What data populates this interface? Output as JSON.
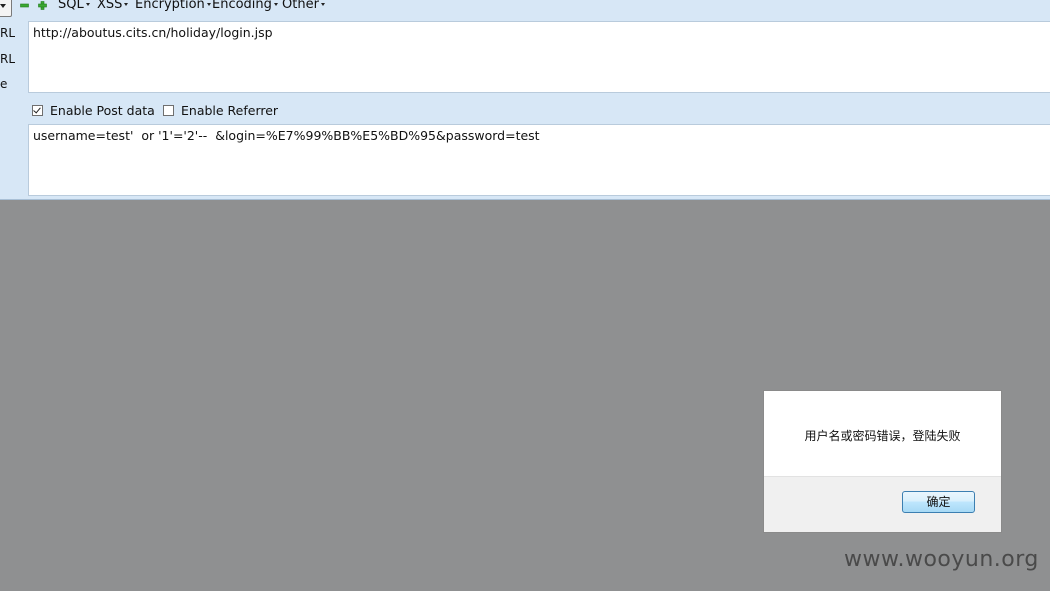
{
  "toolbar": {
    "menus": [
      {
        "label": "SQL"
      },
      {
        "label": "XSS"
      },
      {
        "label": "Encryption"
      },
      {
        "label": "Encoding"
      },
      {
        "label": "Other"
      }
    ],
    "icons": {
      "minus": "minus-icon",
      "plus": "plus-icon"
    },
    "accent_color": "#3aa832"
  },
  "side_labels": [
    "RL",
    "RL",
    "e"
  ],
  "url_field": {
    "value": "http://aboutus.cits.cn/holiday/login.jsp"
  },
  "options": {
    "post_data": {
      "label": "Enable Post data",
      "checked": true
    },
    "referrer": {
      "label": "Enable Referrer",
      "checked": false
    }
  },
  "post_field": {
    "value": "username=test'  or '1'='2'--  &login=%E7%99%BB%E5%BD%95&password=test"
  },
  "dialog": {
    "message": "用户名或密码错误，登陆失败",
    "ok_label": "确定"
  },
  "watermark": "www.wooyun.org"
}
